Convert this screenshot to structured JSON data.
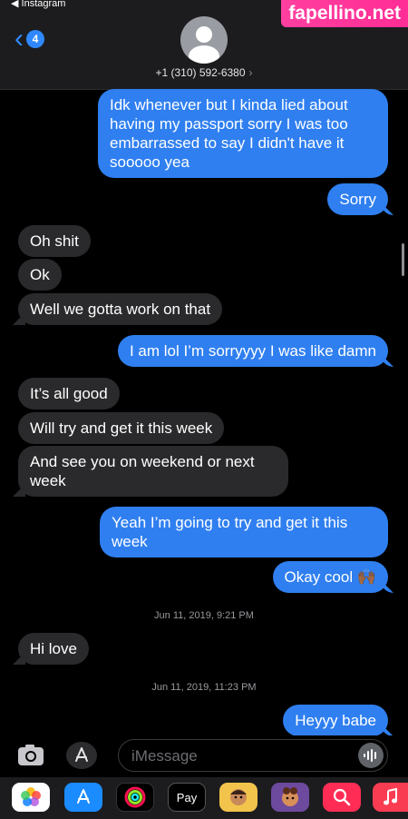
{
  "status_bar": {
    "back_app": "◀ Instagram"
  },
  "watermark": "fapellino.net",
  "header": {
    "back_badge": "4",
    "contact": "+1 (310) 592-6380",
    "contact_chevron": "›"
  },
  "messages": [
    {
      "dir": "sent",
      "text": "Idk whenever but I kinda lied about having my passport sorry I was too embarrassed to say I didn't have it sooooo yea"
    },
    {
      "dir": "sent",
      "text": "Sorry"
    },
    {
      "dir": "recv",
      "text": "Oh shit"
    },
    {
      "dir": "recv",
      "text": "Ok"
    },
    {
      "dir": "recv",
      "text": "Well we gotta work on that"
    },
    {
      "dir": "sent",
      "text": "I am lol I’m sorryyyy I was like damn"
    },
    {
      "dir": "recv",
      "text": "It’s all good"
    },
    {
      "dir": "recv",
      "text": "Will try and get it this week"
    },
    {
      "dir": "recv",
      "text": "And see you on weekend or next week"
    },
    {
      "dir": "sent",
      "text": "Yeah I’m going to try and get it this week"
    },
    {
      "dir": "sent",
      "text": "Okay cool 🙌🏾"
    },
    {
      "dir": "recv",
      "text": "Hi love"
    },
    {
      "dir": "sent",
      "text": "Heyyy babe"
    }
  ],
  "timestamps": [
    {
      "date": "Jun 11, 2019,",
      "time": "9:21 PM"
    },
    {
      "date": "Jun 11, 2019,",
      "time": "11:23 PM"
    }
  ],
  "composer": {
    "placeholder": "iMessage",
    "camera_icon": "camera-icon",
    "apps_icon": "app-store-icon",
    "audio_icon": "waveform-icon"
  },
  "app_drawer": [
    {
      "name": "photos-icon",
      "label": ""
    },
    {
      "name": "app-store-icon",
      "label": ""
    },
    {
      "name": "activity-icon",
      "label": ""
    },
    {
      "name": "apple-pay-icon",
      "label": "Pay"
    },
    {
      "name": "memoji-icon",
      "label": ""
    },
    {
      "name": "animoji-icon",
      "label": ""
    },
    {
      "name": "web-images-icon",
      "label": ""
    },
    {
      "name": "music-icon",
      "label": ""
    }
  ],
  "colors": {
    "sent": "#2f7ff0",
    "received": "#2a2a2c",
    "accent": "#2f88ff",
    "watermark": "#ff2d95"
  }
}
